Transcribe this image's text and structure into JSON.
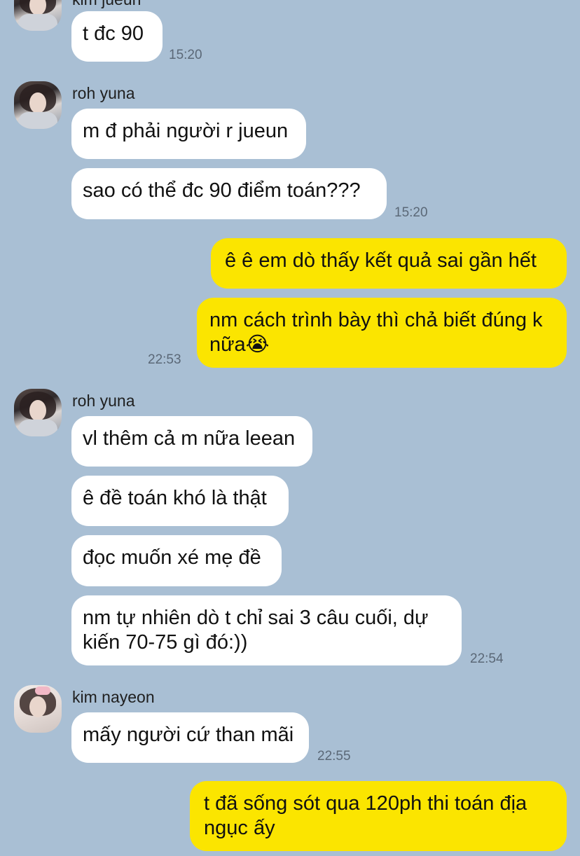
{
  "participants": {
    "jueun": "kim jueun",
    "yuna": "roh yuna",
    "nayeon": "kim nayeon"
  },
  "messages": [
    {
      "text": "t đc 90",
      "time": "15:20"
    },
    {
      "text": "m đ phải người r jueun"
    },
    {
      "text": "sao có thể đc 90 điểm toán???",
      "time": "15:20"
    },
    {
      "text": "ê ê em dò thấy kết quả sai gần hết"
    },
    {
      "text": "nm cách trình bày thì chả biết đúng k nữa😭",
      "time": "22:53"
    },
    {
      "text": "vl thêm cả m nữa leean"
    },
    {
      "text": "ê đề toán khó là thật"
    },
    {
      "text": "đọc muốn xé mẹ đề"
    },
    {
      "text": "nm tự nhiên dò t chỉ sai 3 câu cuối, dự kiến 70-75 gì đó:))",
      "time": "22:54"
    },
    {
      "text": "mấy người cứ than mãi",
      "time": "22:55"
    },
    {
      "text": "t đã sống sót qua 120ph thi toán địa ngục ấy"
    }
  ],
  "colors": {
    "background": "#a9bfd4",
    "incoming_bubble": "#ffffff",
    "outgoing_bubble": "#fbe500"
  }
}
